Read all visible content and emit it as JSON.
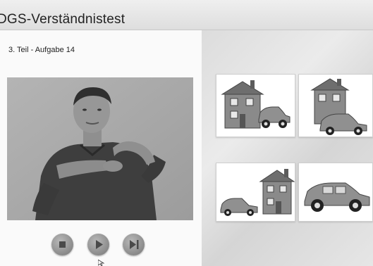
{
  "header": {
    "title": "DGS-Verständnistest"
  },
  "task": {
    "label": "3. Teil - Aufgabe  14"
  },
  "video": {
    "description_icon": "signer-video"
  },
  "controls": {
    "buttons": [
      {
        "name": "stop-button",
        "icon": "stop-icon"
      },
      {
        "name": "play-button",
        "icon": "play-icon"
      },
      {
        "name": "next-button",
        "icon": "skip-end-icon"
      }
    ]
  },
  "answers": [
    {
      "name": "answer-option-1",
      "depicts": "car-right-of-house"
    },
    {
      "name": "answer-option-2",
      "depicts": "car-in-front-of-house"
    },
    {
      "name": "answer-option-3",
      "depicts": "car-left-of-house"
    },
    {
      "name": "answer-option-4",
      "depicts": "car-only"
    }
  ],
  "colors": {
    "title_bar": "#e4e4e4",
    "panel": "#fafafa",
    "button": "#8a8a8a"
  }
}
